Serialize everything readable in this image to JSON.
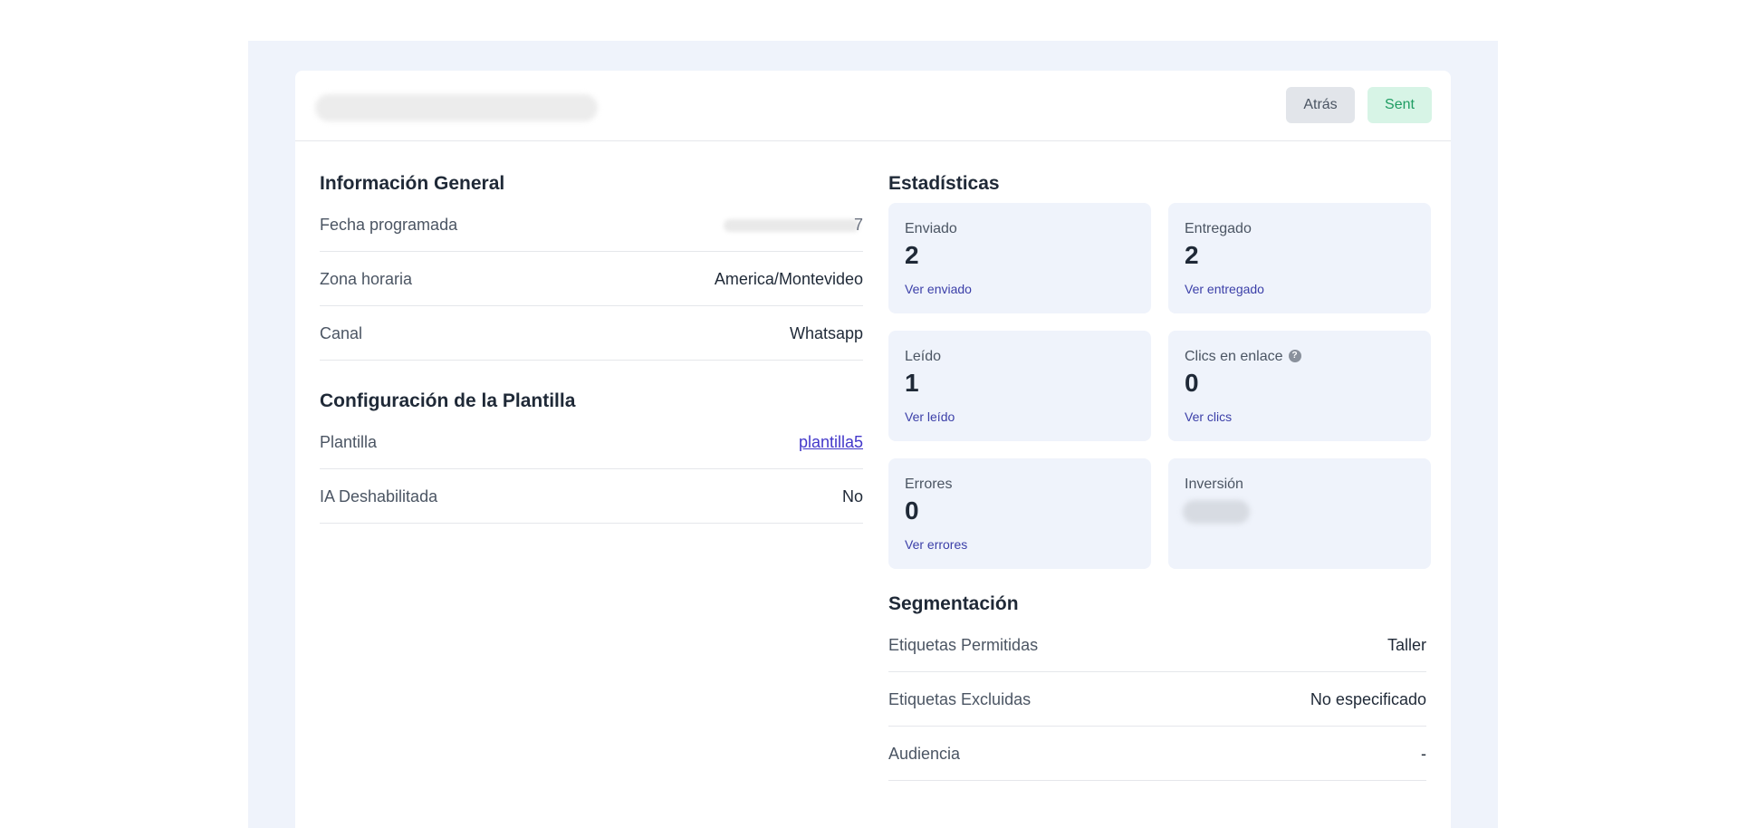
{
  "header": {
    "back_label": "Atrás",
    "status_label": "Sent"
  },
  "general": {
    "title": "Información General",
    "scheduled_label": "Fecha programada",
    "scheduled_tail": "7",
    "timezone_label": "Zona horaria",
    "timezone_value": "America/Montevideo",
    "channel_label": "Canal",
    "channel_value": "Whatsapp"
  },
  "template": {
    "title": "Configuración de la Plantilla",
    "template_label": "Plantilla",
    "template_value": "plantilla5",
    "ai_label": "IA Deshabilitada",
    "ai_value": "No"
  },
  "stats": {
    "title": "Estadísticas",
    "sent": {
      "label": "Enviado",
      "value": "2",
      "link": "Ver enviado"
    },
    "delivered": {
      "label": "Entregado",
      "value": "2",
      "link": "Ver entregado"
    },
    "read": {
      "label": "Leído",
      "value": "1",
      "link": "Ver leído"
    },
    "clicks": {
      "label": "Clics en enlace",
      "value": "0",
      "link": "Ver clics",
      "help": "?"
    },
    "errors": {
      "label": "Errores",
      "value": "0",
      "link": "Ver errores"
    },
    "investment": {
      "label": "Inversión"
    }
  },
  "segmentation": {
    "title": "Segmentación",
    "allowed_label": "Etiquetas Permitidas",
    "allowed_value": "Taller",
    "excluded_label": "Etiquetas Excluidas",
    "excluded_value": "No especificado",
    "audience_label": "Audiencia",
    "audience_value": "-"
  },
  "colors": {
    "page_bg": "#eff3fb",
    "card_bg": "#ffffff",
    "sent_badge_bg": "#d7f4e6",
    "sent_badge_text": "#1f9d63",
    "link": "#4338ca"
  }
}
